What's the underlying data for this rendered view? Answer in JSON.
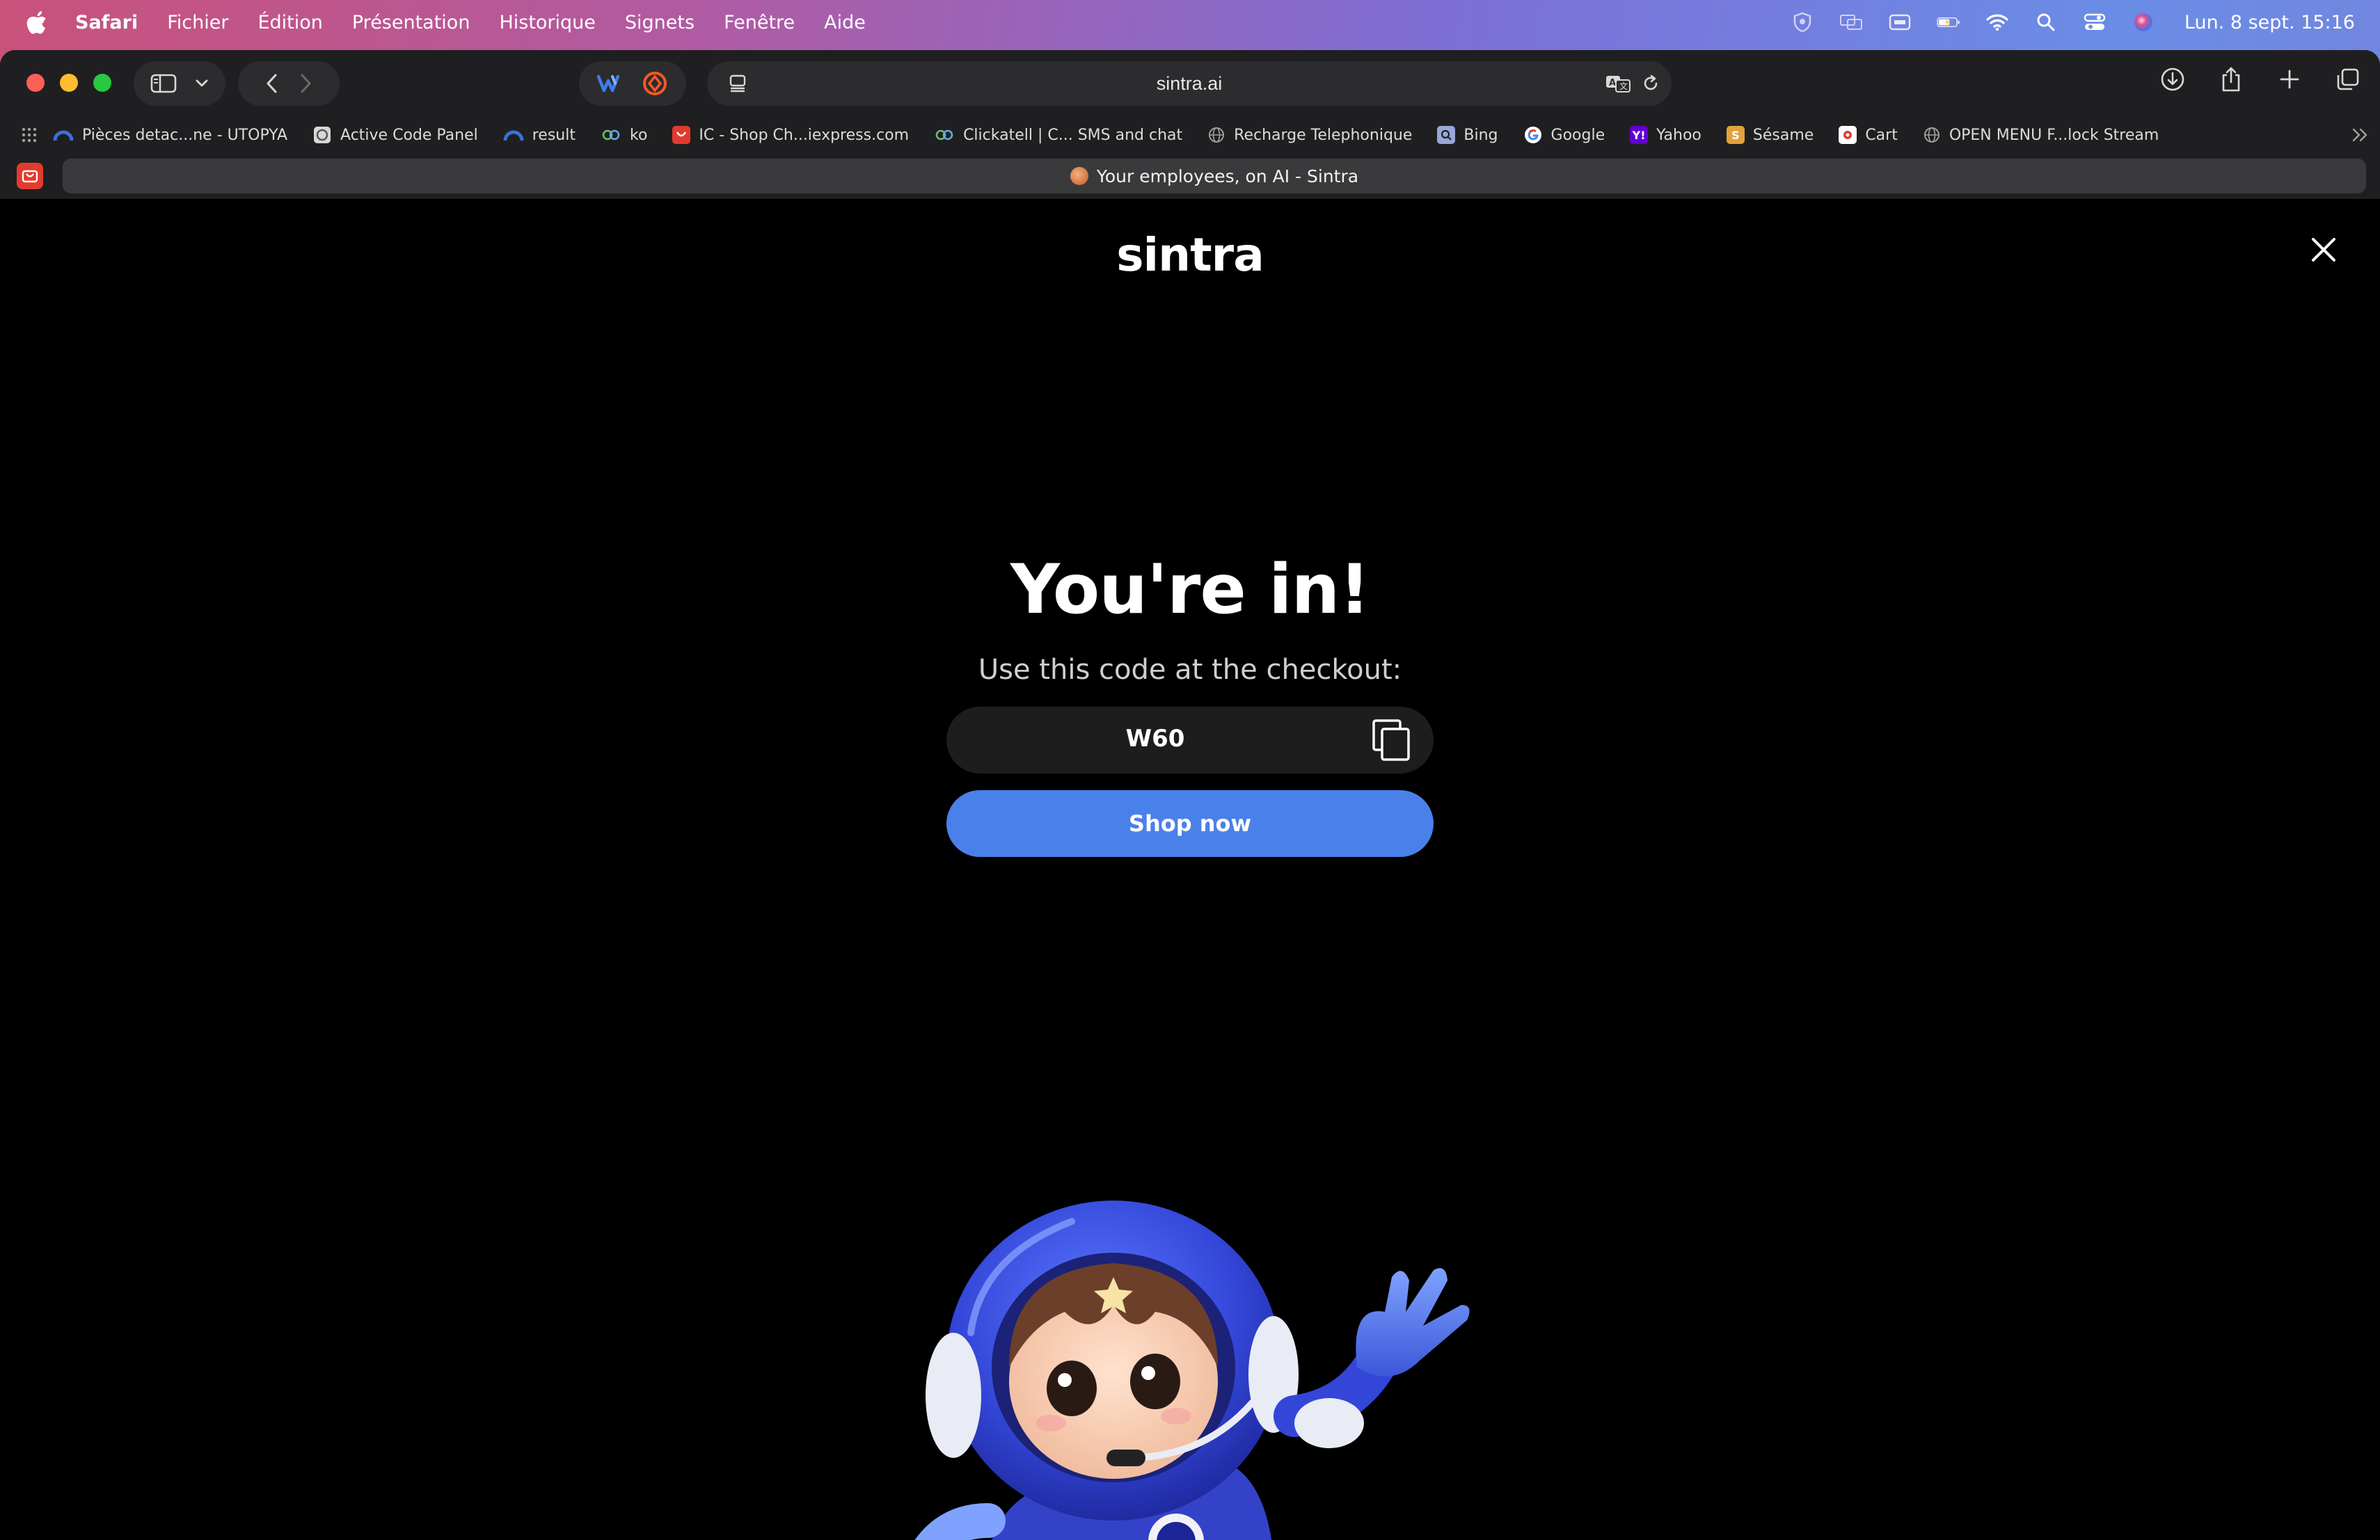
{
  "menubar": {
    "app_name": "Safari",
    "menus": [
      "Fichier",
      "Édition",
      "Présentation",
      "Historique",
      "Signets",
      "Fenêtre",
      "Aide"
    ],
    "clock": "Lun. 8 sept. 15:16",
    "status_icons": [
      "shield-icon",
      "screen-mirror-icon",
      "caption-icon",
      "battery-charging-icon",
      "wifi-icon",
      "search-icon",
      "control-center-icon",
      "siri-icon"
    ]
  },
  "toolbar": {
    "url": "sintra.ai"
  },
  "favorites": [
    {
      "label": "Pièces detac...ne - UTOPYA",
      "icon": "utopya-icon",
      "color": "#3b6fd8"
    },
    {
      "label": "Active Code Panel",
      "icon": "panel-icon",
      "color": "#8e8e93"
    },
    {
      "label": "result",
      "icon": "utopya-icon",
      "color": "#3b6fd8"
    },
    {
      "label": "ko",
      "icon": "link-icon",
      "color": "#6bbf6b"
    },
    {
      "label": "IC - Shop Ch...iexpress.com",
      "icon": "aliexpress-icon",
      "color": "#e23b2e"
    },
    {
      "label": "Clickatell | C... SMS and chat",
      "icon": "link-icon",
      "color": "#6bbf6b"
    },
    {
      "label": "Recharge Telephonique",
      "icon": "globe-icon",
      "color": "#8e8e93"
    },
    {
      "label": "Bing",
      "icon": "bing-icon",
      "color": "#9aa7d8"
    },
    {
      "label": "Google",
      "icon": "google-icon",
      "color": "#ffffff"
    },
    {
      "label": "Yahoo",
      "icon": "yahoo-icon",
      "color": "#6001d2"
    },
    {
      "label": "Sésame",
      "icon": "sesame-icon",
      "color": "#e2a33a"
    },
    {
      "label": "Cart",
      "icon": "cart-icon",
      "color": "#ffffff"
    },
    {
      "label": "OPEN MENU F...lock Stream",
      "icon": "globe-icon",
      "color": "#8e8e93"
    }
  ],
  "tab": {
    "title": "Your employees, on AI - Sintra"
  },
  "page": {
    "logo": "sintra",
    "headline": "You're in!",
    "subtext": "Use this code at the checkout:",
    "code": "W60",
    "shop_button": "Shop now",
    "accent_color": "#4a80ea"
  }
}
